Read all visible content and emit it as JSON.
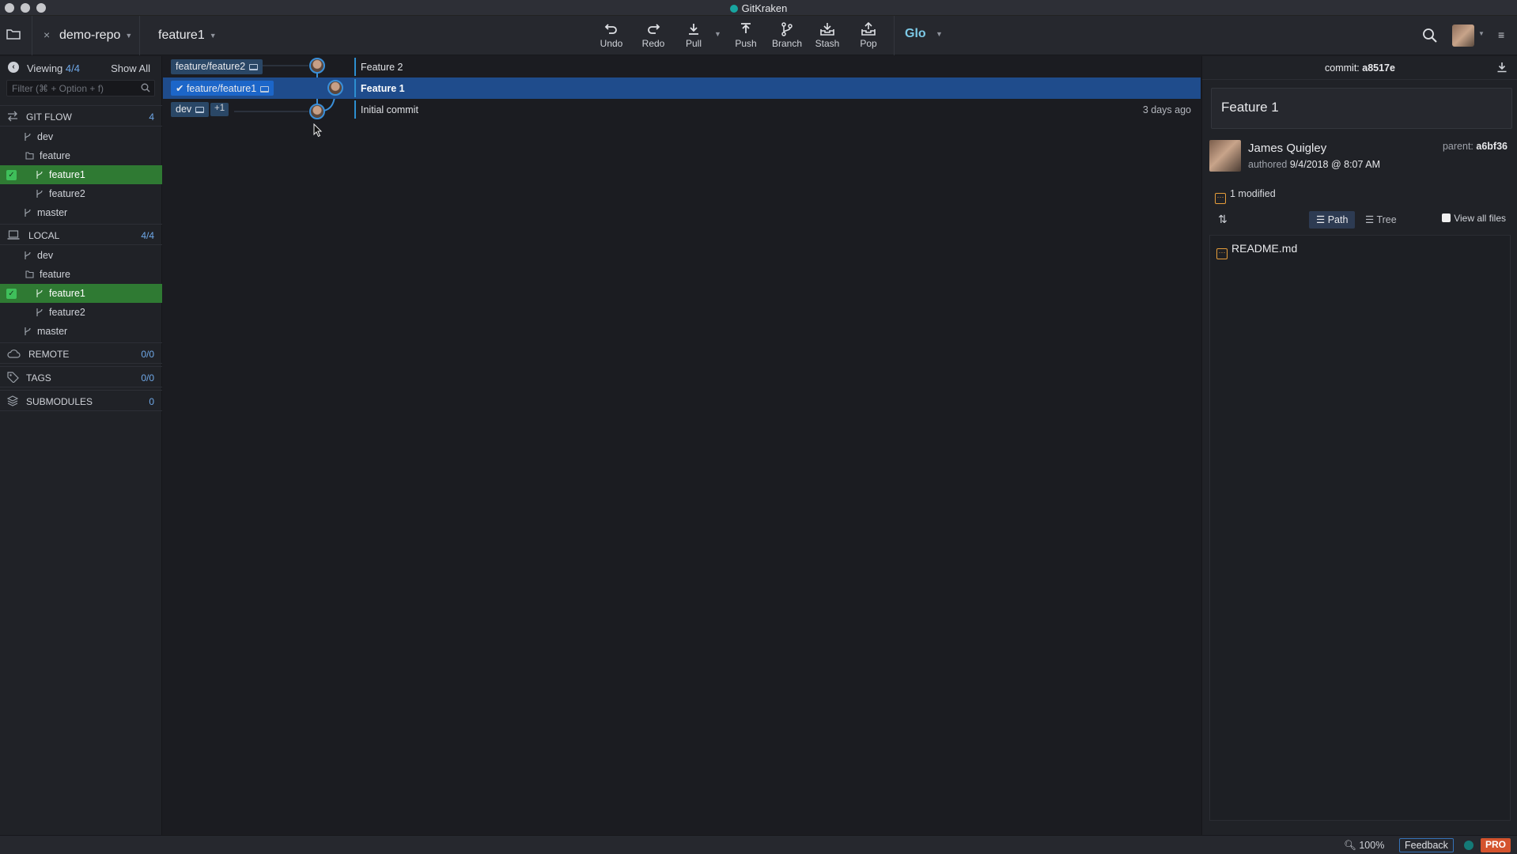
{
  "window": {
    "title": "GitKraken"
  },
  "toolbar": {
    "repo_tab": "demo-repo",
    "branch_tab": "feature1",
    "close": "×",
    "buttons": [
      {
        "label": "Undo",
        "icon": "undo-icon"
      },
      {
        "label": "Redo",
        "icon": "redo-icon"
      },
      {
        "label": "Pull",
        "icon": "pull-icon"
      },
      {
        "label": "Push",
        "icon": "push-icon"
      },
      {
        "label": "Branch",
        "icon": "branch-icon"
      },
      {
        "label": "Stash",
        "icon": "stash-icon"
      },
      {
        "label": "Pop",
        "icon": "pop-icon"
      }
    ],
    "glo": "Glo"
  },
  "sidebar": {
    "viewing_label": "Viewing",
    "viewing_count": "4/4",
    "show_all": "Show All",
    "filter_placeholder": "Filter (⌘ + Option + f)",
    "git_flow": {
      "label": "GIT FLOW",
      "count": "4",
      "items": [
        "dev",
        "feature",
        "feature1",
        "feature2",
        "master"
      ]
    },
    "local": {
      "label": "LOCAL",
      "count": "4/4",
      "items": [
        "dev",
        "feature",
        "feature1",
        "feature2",
        "master"
      ]
    },
    "remote": {
      "label": "REMOTE",
      "count": "0/0"
    },
    "tags": {
      "label": "TAGS",
      "count": "0/0"
    },
    "submodules": {
      "label": "SUBMODULES",
      "count": "0"
    }
  },
  "graph": {
    "rows": [
      {
        "ref": "feature/feature2",
        "message": "Feature 2",
        "time": ""
      },
      {
        "ref": "feature/feature1",
        "message": "Feature 1",
        "time": "",
        "selected": true
      },
      {
        "ref": "dev",
        "extra": "+1",
        "message": "Initial commit",
        "time": "3 days ago"
      }
    ]
  },
  "commit_panel": {
    "commit_label": "commit:",
    "commit_sha": "a8517e",
    "message": "Feature 1",
    "author": "James Quigley",
    "authored_label": "authored",
    "authored_date": "9/4/2018 @ 8:07 AM",
    "parent_label": "parent:",
    "parent_sha": "a6bf36",
    "modified": "1 modified",
    "path_label": "Path",
    "tree_label": "Tree",
    "view_all_files": "View all files",
    "files": [
      "README.md"
    ]
  },
  "statusbar": {
    "zoom": "100%",
    "feedback": "Feedback",
    "pro": "PRO"
  },
  "colors": {
    "accent": "#1c66c9",
    "active_branch": "#2f7a33",
    "pro_badge": "#d4532d",
    "modified": "#e69d3a"
  }
}
